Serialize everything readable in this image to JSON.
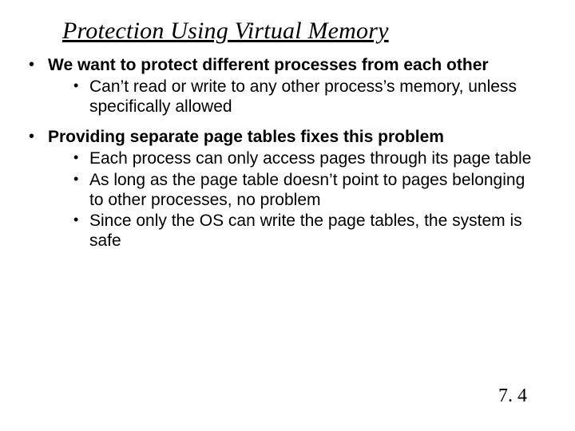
{
  "title": "Protection Using Virtual Memory",
  "bullets": [
    {
      "header": "We want to protect different processes from each other",
      "subs": [
        "Can’t read or write to any other process’s memory, unless specifically allowed"
      ]
    },
    {
      "header": "Providing separate page tables fixes this problem",
      "subs": [
        "Each process can only access pages through its page table",
        "As long as the page table doesn’t point to pages belonging to other processes, no problem",
        "Since only the OS can write the page tables, the system is safe"
      ]
    }
  ],
  "footer": "7. 4"
}
